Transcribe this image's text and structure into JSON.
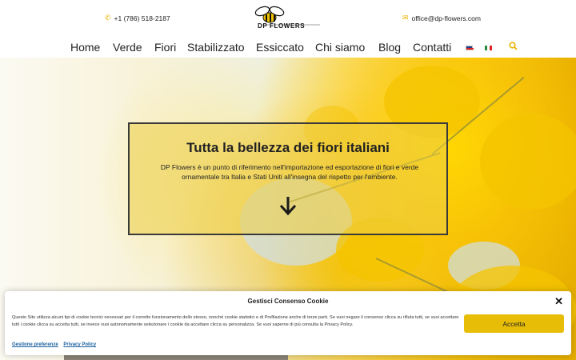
{
  "header": {
    "phone": "+1 (786) 518-2187",
    "email": "office@dp-flowers.com",
    "logo_text": "DP FLOWERS",
    "phone_icon": "phone-icon",
    "email_icon": "email-icon"
  },
  "nav": {
    "items": [
      "Home",
      "Verde",
      "Fiori",
      "Stabilizzato",
      "Essiccato",
      "Chi siamo",
      "Blog",
      "Contatti"
    ],
    "languages": [
      "en-flag-icon",
      "it-flag-icon"
    ],
    "search_icon": "search-icon"
  },
  "hero": {
    "title": "Tutta la bellezza dei fiori italiani",
    "text": "DP Flowers è un punto di riferimento nell'importazione ed esportazione di fiori e verde ornamentale tra Italia e Stati Uniti all'insegna del rispetto per l'ambiente.",
    "arrow_icon": "arrow-down-icon"
  },
  "cookie": {
    "title": "Gestisci Consenso Cookie",
    "text": "Questo Sito utilizza alcuni tipi di cookie tecnici necessari per il corretto funzionamento dello stesso, nonché cookie statistici e di Profilazione anche di terze parti. Se vuoi negare il consenso clicca su rifiuta tutti, se vuoi accettare tutti i cookie clicca su accetta tutti, se invece vuoi   autonomamente selezionare i cookie da accettare clicca su personalizza. Se vuoi saperne di più consulta la Privacy Policy.",
    "accept_label": "Accetta",
    "preferences_label": "Gestione preferenze",
    "privacy_label": "Privacy Policy"
  },
  "colors": {
    "accent": "#e8bd08",
    "link": "#1a5f9e"
  }
}
